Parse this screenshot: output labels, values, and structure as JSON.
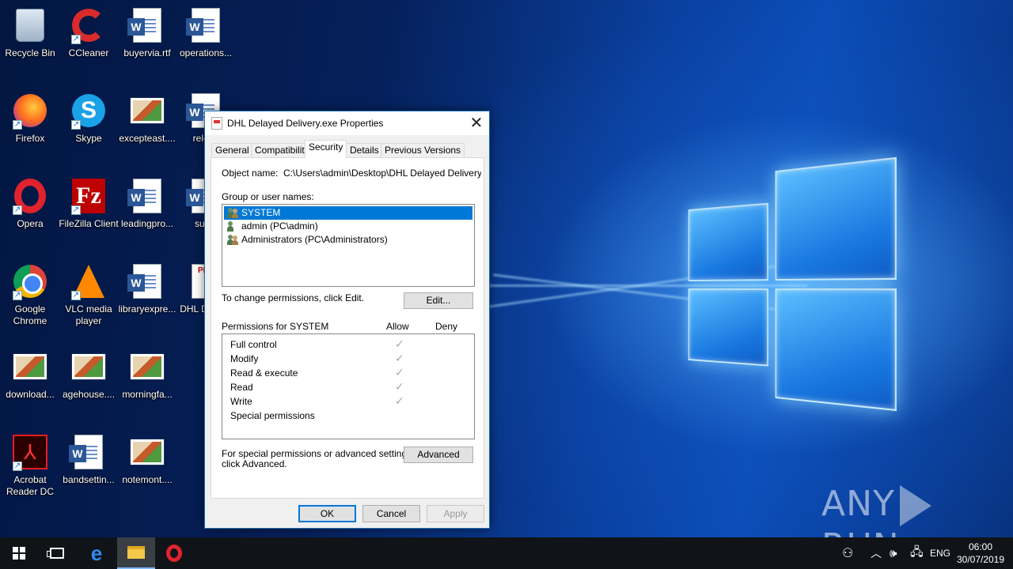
{
  "desktop": {
    "icons": [
      {
        "label": "Recycle Bin",
        "icon": "recycle-bin-icon"
      },
      {
        "label": "CCleaner",
        "icon": "ccleaner-icon"
      },
      {
        "label": "buyervia.rtf",
        "icon": "word-document-icon"
      },
      {
        "label": "operations...",
        "icon": "word-document-icon"
      },
      {
        "label": "Firefox",
        "icon": "firefox-icon"
      },
      {
        "label": "Skype",
        "icon": "skype-icon"
      },
      {
        "label": "excepteast....",
        "icon": "image-file-icon"
      },
      {
        "label": "releas",
        "icon": "word-document-icon"
      },
      {
        "label": "Opera",
        "icon": "opera-icon"
      },
      {
        "label": "FileZilla Client",
        "icon": "filezilla-icon"
      },
      {
        "label": "leadingpro...",
        "icon": "word-document-icon"
      },
      {
        "label": "suchi",
        "icon": "word-document-icon"
      },
      {
        "label": "Google Chrome",
        "icon": "chrome-icon"
      },
      {
        "label": "VLC media player",
        "icon": "vlc-icon"
      },
      {
        "label": "libraryexpre...",
        "icon": "word-document-icon"
      },
      {
        "label": "DHL D Deliv",
        "icon": "pdf-file-icon"
      },
      {
        "label": "download...",
        "icon": "image-file-icon"
      },
      {
        "label": "agehouse....",
        "icon": "image-file-icon"
      },
      {
        "label": "morningfa...",
        "icon": "image-file-icon"
      },
      {
        "label": "Acrobat Reader DC",
        "icon": "acrobat-icon"
      },
      {
        "label": "bandsettin...",
        "icon": "word-document-icon"
      },
      {
        "label": "notemont....",
        "icon": "image-file-icon"
      }
    ]
  },
  "dialog": {
    "title": "DHL Delayed Delivery.exe Properties",
    "close_glyph": "✕",
    "tabs": [
      "General",
      "Compatibility",
      "Security",
      "Details",
      "Previous Versions"
    ],
    "active_tab": "Security",
    "object_name_label": "Object name:",
    "object_name_value": "C:\\Users\\admin\\Desktop\\DHL Delayed Delivery.e",
    "group_label": "Group or user names:",
    "users": [
      {
        "name": "SYSTEM",
        "selected": true
      },
      {
        "name": "admin (PC\\admin)",
        "selected": false
      },
      {
        "name": "Administrators (PC\\Administrators)",
        "selected": false
      }
    ],
    "change_text": "To change permissions, click Edit.",
    "edit_button": "Edit...",
    "permissions_label": "Permissions for SYSTEM",
    "allow_header": "Allow",
    "deny_header": "Deny",
    "permissions": [
      {
        "name": "Full control",
        "allow": true,
        "deny": false
      },
      {
        "name": "Modify",
        "allow": true,
        "deny": false
      },
      {
        "name": "Read & execute",
        "allow": true,
        "deny": false
      },
      {
        "name": "Read",
        "allow": true,
        "deny": false
      },
      {
        "name": "Write",
        "allow": true,
        "deny": false
      },
      {
        "name": "Special permissions",
        "allow": false,
        "deny": false
      }
    ],
    "check_glyph": "✓",
    "special_text_1": "For special permissions or advanced settings,",
    "special_text_2": "click Advanced.",
    "advanced_button": "Advanced",
    "ok_button": "OK",
    "cancel_button": "Cancel",
    "apply_button": "Apply"
  },
  "watermark": {
    "left": "ANY",
    "right": "RUN"
  },
  "taskbar": {
    "language": "ENG",
    "time": "06:00",
    "date": "30/07/2019",
    "tray_glyphs": {
      "people": "⚇",
      "chevron": "︿",
      "volume": "🕪",
      "network": "🖧"
    }
  }
}
